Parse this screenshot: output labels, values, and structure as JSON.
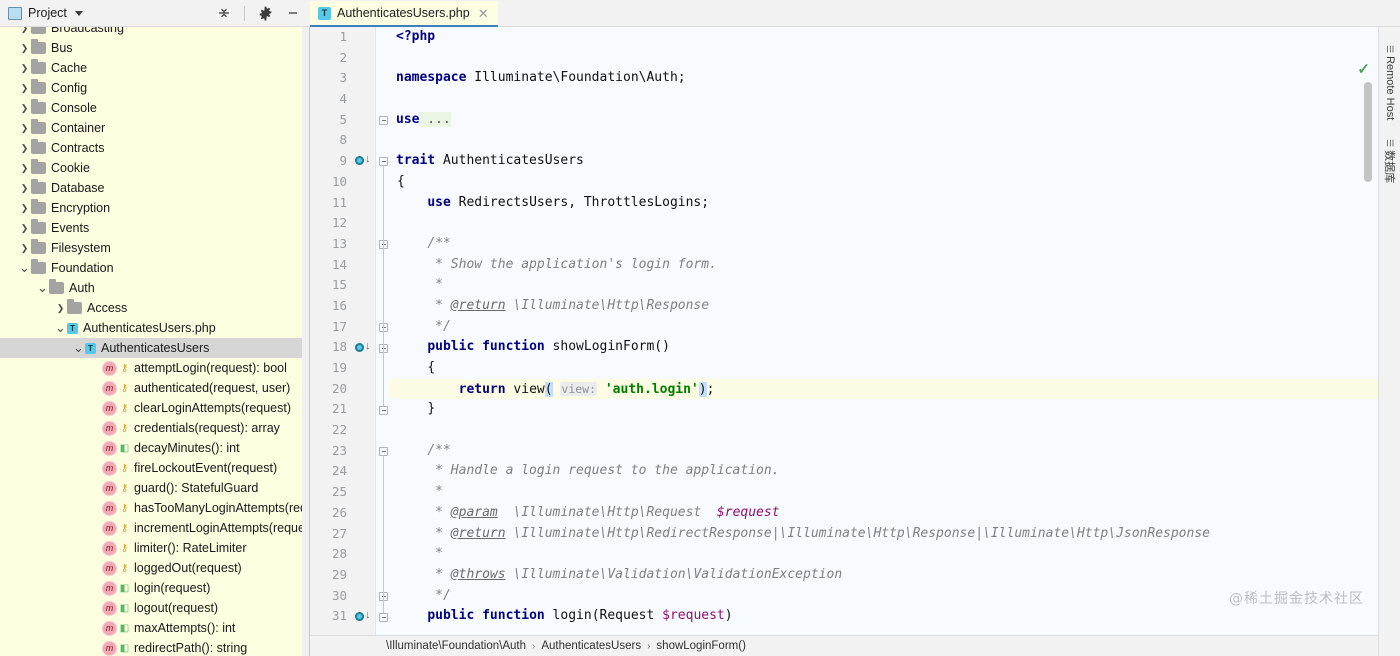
{
  "toolbar": {
    "project_label": "Project",
    "project_icon": "project-panel-icon",
    "dropdown_icon": "chevron-down-icon",
    "collapse_all_icon": "collapse-all-icon",
    "settings_icon": "gear-icon",
    "minimize_icon": "minimize-icon"
  },
  "tabs": [
    {
      "label": "AuthenticatesUsers.php",
      "icon": "T",
      "close_icon": "close-icon",
      "active": true
    }
  ],
  "sidebar": {
    "scrollbar": "sidebar-scrollbar",
    "items": [
      {
        "label": "Broadcasting",
        "type": "folder",
        "indent": 1,
        "arrow": "›",
        "clipped": true
      },
      {
        "label": "Bus",
        "type": "folder",
        "indent": 1,
        "arrow": "›"
      },
      {
        "label": "Cache",
        "type": "folder",
        "indent": 1,
        "arrow": "›"
      },
      {
        "label": "Config",
        "type": "folder",
        "indent": 1,
        "arrow": "›"
      },
      {
        "label": "Console",
        "type": "folder",
        "indent": 1,
        "arrow": "›"
      },
      {
        "label": "Container",
        "type": "folder",
        "indent": 1,
        "arrow": "›"
      },
      {
        "label": "Contracts",
        "type": "folder",
        "indent": 1,
        "arrow": "›"
      },
      {
        "label": "Cookie",
        "type": "folder",
        "indent": 1,
        "arrow": "›"
      },
      {
        "label": "Database",
        "type": "folder",
        "indent": 1,
        "arrow": "›"
      },
      {
        "label": "Encryption",
        "type": "folder",
        "indent": 1,
        "arrow": "›"
      },
      {
        "label": "Events",
        "type": "folder",
        "indent": 1,
        "arrow": "›"
      },
      {
        "label": "Filesystem",
        "type": "folder",
        "indent": 1,
        "arrow": "›"
      },
      {
        "label": "Foundation",
        "type": "folder",
        "indent": 1,
        "arrow": "⌄",
        "expanded": true
      },
      {
        "label": "Auth",
        "type": "folder",
        "indent": 2,
        "arrow": "⌄",
        "expanded": true
      },
      {
        "label": "Access",
        "type": "folder",
        "indent": 3,
        "arrow": "›"
      },
      {
        "label": "AuthenticatesUsers.php",
        "type": "trait",
        "indent": 3,
        "arrow": "⌄",
        "expanded": true
      },
      {
        "label": "AuthenticatesUsers",
        "type": "trait",
        "indent": 4,
        "arrow": "⌄",
        "expanded": true,
        "selected": true
      },
      {
        "label": "attemptLogin(request): bool",
        "type": "method",
        "indent": 5,
        "vis": "protected"
      },
      {
        "label": "authenticated(request, user)",
        "type": "method",
        "indent": 5,
        "vis": "protected"
      },
      {
        "label": "clearLoginAttempts(request)",
        "type": "method",
        "indent": 5,
        "vis": "protected"
      },
      {
        "label": "credentials(request): array",
        "type": "method",
        "indent": 5,
        "vis": "protected"
      },
      {
        "label": "decayMinutes(): int",
        "type": "method",
        "indent": 5,
        "vis": "public"
      },
      {
        "label": "fireLockoutEvent(request)",
        "type": "method",
        "indent": 5,
        "vis": "protected"
      },
      {
        "label": "guard(): StatefulGuard",
        "type": "method",
        "indent": 5,
        "vis": "protected"
      },
      {
        "label": "hasTooManyLoginAttempts(request)",
        "type": "method",
        "indent": 5,
        "vis": "protected"
      },
      {
        "label": "incrementLoginAttempts(request)",
        "type": "method",
        "indent": 5,
        "vis": "protected"
      },
      {
        "label": "limiter(): RateLimiter",
        "type": "method",
        "indent": 5,
        "vis": "protected"
      },
      {
        "label": "loggedOut(request)",
        "type": "method",
        "indent": 5,
        "vis": "protected"
      },
      {
        "label": "login(request)",
        "type": "method",
        "indent": 5,
        "vis": "public"
      },
      {
        "label": "logout(request)",
        "type": "method",
        "indent": 5,
        "vis": "public"
      },
      {
        "label": "maxAttempts(): int",
        "type": "method",
        "indent": 5,
        "vis": "public"
      },
      {
        "label": "redirectPath(): string",
        "type": "method",
        "indent": 5,
        "vis": "public"
      }
    ]
  },
  "editor": {
    "lines": [
      {
        "n": "1",
        "marker": false,
        "fold": null
      },
      {
        "n": "2",
        "marker": false,
        "fold": null
      },
      {
        "n": "3",
        "marker": false,
        "fold": null
      },
      {
        "n": "4",
        "marker": false,
        "fold": null
      },
      {
        "n": "5",
        "marker": false,
        "fold": "box"
      },
      {
        "n": "8",
        "marker": false,
        "fold": null
      },
      {
        "n": "9",
        "marker": true,
        "fold": "box"
      },
      {
        "n": "10",
        "marker": false,
        "fold": null
      },
      {
        "n": "11",
        "marker": false,
        "fold": null
      },
      {
        "n": "12",
        "marker": false,
        "fold": null
      },
      {
        "n": "13",
        "marker": false,
        "fold": "box"
      },
      {
        "n": "14",
        "marker": false,
        "fold": null
      },
      {
        "n": "15",
        "marker": false,
        "fold": null
      },
      {
        "n": "16",
        "marker": false,
        "fold": null
      },
      {
        "n": "17",
        "marker": false,
        "fold": "box"
      },
      {
        "n": "18",
        "marker": true,
        "fold": "box"
      },
      {
        "n": "19",
        "marker": false,
        "fold": null
      },
      {
        "n": "20",
        "marker": false,
        "fold": null,
        "highlight": true
      },
      {
        "n": "21",
        "marker": false,
        "fold": "box"
      },
      {
        "n": "22",
        "marker": false,
        "fold": null
      },
      {
        "n": "23",
        "marker": false,
        "fold": "box"
      },
      {
        "n": "24",
        "marker": false,
        "fold": null
      },
      {
        "n": "25",
        "marker": false,
        "fold": null
      },
      {
        "n": "26",
        "marker": false,
        "fold": null
      },
      {
        "n": "27",
        "marker": false,
        "fold": null
      },
      {
        "n": "28",
        "marker": false,
        "fold": null
      },
      {
        "n": "29",
        "marker": false,
        "fold": null
      },
      {
        "n": "30",
        "marker": false,
        "fold": "box"
      },
      {
        "n": "31",
        "marker": true,
        "fold": "box"
      }
    ],
    "code_text": {
      "l1": "<?php",
      "l3": "namespace Illuminate\\Foundation\\Auth;",
      "l5": "use ...",
      "l9": "trait AuthenticatesUsers",
      "l10": "{",
      "l11": "    use RedirectsUsers, ThrottlesLogins;",
      "l13": "    /**",
      "l14": "     * Show the application's login form.",
      "l15": "     *",
      "l16": "     * @return \\Illuminate\\Http\\Response",
      "l17": "     */",
      "l18": "    public function showLoginForm()",
      "l19": "    {",
      "l20": "        return view( view: 'auth.login');",
      "l21": "    }",
      "l23": "    /**",
      "l24": "     * Handle a login request to the application.",
      "l25": "     *",
      "l26": "     * @param  \\Illuminate\\Http\\Request  $request",
      "l27": "     * @return \\Illuminate\\Http\\RedirectResponse|\\Illuminate\\Http\\Response|\\Illuminate\\Http\\JsonResponse",
      "l28": "     *",
      "l29": "     * @throws \\Illuminate\\Validation\\ValidationException",
      "l30": "     */",
      "l31": "    public function login(Request $request)"
    },
    "tokens": {
      "php_open": "<?php",
      "kw_namespace": "namespace",
      "ns_path": " Illuminate\\Foundation\\Auth;",
      "kw_use": "use",
      "fold_ellipsis": " ...",
      "kw_trait": "trait",
      "trait_name": " AuthenticatesUsers",
      "brace_open": "{",
      "use_traits": " RedirectsUsers, ThrottlesLogins;",
      "doc_open": "/**",
      "doc_close": "*/",
      "doc_star": "*",
      "doc_show": "* Show the application's login form.",
      "tag_return": "@return",
      "type_response": " \\Illuminate\\Http\\Response",
      "kw_public": "public",
      "kw_function": "function",
      "fn_showLoginForm": " showLoginForm()",
      "kw_return": "return",
      "fn_view": " view",
      "paren_open": "(",
      "hint_view": "view:",
      "str_authlogin": "'auth.login'",
      "paren_close": ")",
      "semicolon": ";",
      "brace_close": "}",
      "doc_handle": "* Handle a login request to the application.",
      "tag_param": "@param",
      "type_request": "  \\Illuminate\\Http\\Request",
      "var_request": "  $request",
      "type_union": " \\Illuminate\\Http\\RedirectResponse|\\Illuminate\\Http\\Response|\\Illuminate\\Http\\JsonResponse",
      "tag_throws": "@throws",
      "type_validation": " \\Illuminate\\Validation\\ValidationException",
      "fn_login": " login(Request ",
      "var_request2": "$request",
      "paren_close2": ")"
    },
    "inspection_status_icon": "checkmark-icon",
    "scrollbar": "editor-vertical-scrollbar"
  },
  "breadcrumb": [
    "\\Illuminate\\Foundation\\Auth",
    "AuthenticatesUsers",
    "showLoginForm()"
  ],
  "breadcrumb_sep": "›",
  "right_rail": [
    {
      "label": "Remote Host",
      "icon": "remote-host-icon"
    },
    {
      "label": "数据库",
      "icon": "database-icon"
    }
  ],
  "watermark": "@稀土掘金技术社区",
  "colors": {
    "sidebar_bg": "#FDFDE0",
    "editor_bg": "#F7FAFF",
    "tab_active_bg": "#FDFDE3",
    "tab_underline": "#3E7FBE",
    "caret_line": "#FCFBE3",
    "keyword": "#000080",
    "string": "#008000",
    "comment": "#808080",
    "variable": "#8F0F6E",
    "selection": "#D6D6D6"
  }
}
